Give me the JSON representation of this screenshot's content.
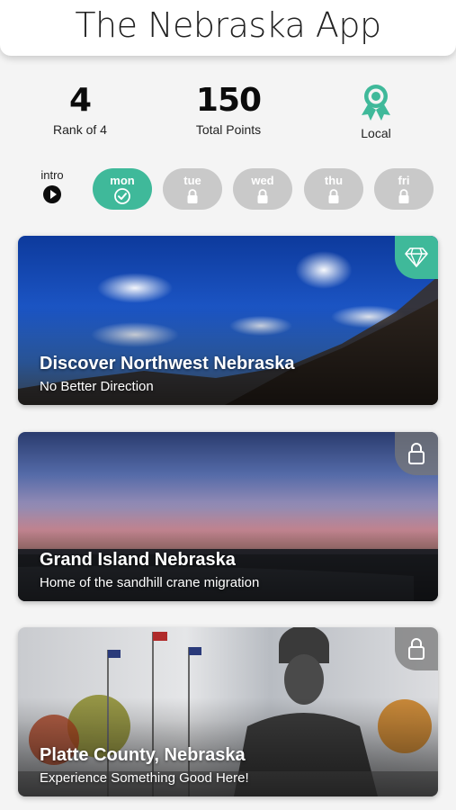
{
  "app": {
    "title": "The Nebraska App"
  },
  "stats": {
    "rank": {
      "value": "4",
      "label": "Rank of 4"
    },
    "points": {
      "value": "150",
      "label": "Total Points"
    },
    "status": {
      "label": "Local",
      "icon": "award-ribbon-icon",
      "color": "#3fb99a"
    }
  },
  "days": {
    "intro": {
      "label": "intro",
      "icon": "play-icon"
    },
    "items": [
      {
        "label": "mon",
        "state": "completed",
        "icon": "check-circle-icon"
      },
      {
        "label": "tue",
        "state": "locked",
        "icon": "lock-icon"
      },
      {
        "label": "wed",
        "state": "locked",
        "icon": "lock-icon"
      },
      {
        "label": "thu",
        "state": "locked",
        "icon": "lock-icon"
      },
      {
        "label": "fri",
        "state": "locked",
        "icon": "lock-icon"
      }
    ]
  },
  "cards": [
    {
      "title": "Discover Northwest Nebraska",
      "subtitle": "No Better Direction",
      "corner_icon": "gem-icon"
    },
    {
      "title": "Grand Island Nebraska",
      "subtitle": "Home of the sandhill crane migration",
      "corner_icon": "lock-icon"
    },
    {
      "title": "Platte County, Nebraska",
      "subtitle": "Experience Something Good Here!",
      "corner_icon": "lock-icon"
    }
  ],
  "colors": {
    "accent": "#3fb99a",
    "inactive": "#c9c9c9",
    "background": "#f4f4f4"
  }
}
